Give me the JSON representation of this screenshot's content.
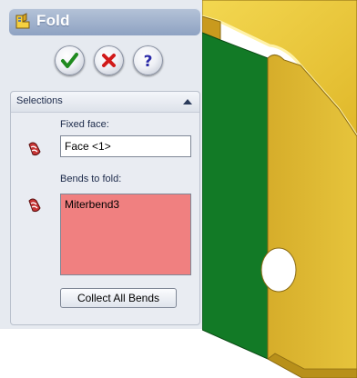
{
  "property_manager": {
    "title": "Fold",
    "actions": [
      {
        "name": "ok",
        "icon": "green-checkmark-icon"
      },
      {
        "name": "cancel",
        "icon": "red-x-icon"
      },
      {
        "name": "help",
        "icon": "question-mark-icon"
      }
    ],
    "selections": {
      "header": "Selections",
      "fixed_face": {
        "label": "Fixed face:",
        "value": "Face <1>"
      },
      "bends_to_fold": {
        "label": "Bends to fold:",
        "items": [
          "Miterbend3"
        ],
        "highlight_color": "#f08080"
      },
      "collect_button": "Collect All Bends"
    }
  },
  "viewport": {
    "colors": {
      "part_yellow": "#e8c233",
      "part_dark_yellow": "#b8901a",
      "selected_face_green": "#127a26",
      "background": "#ffffff"
    }
  }
}
